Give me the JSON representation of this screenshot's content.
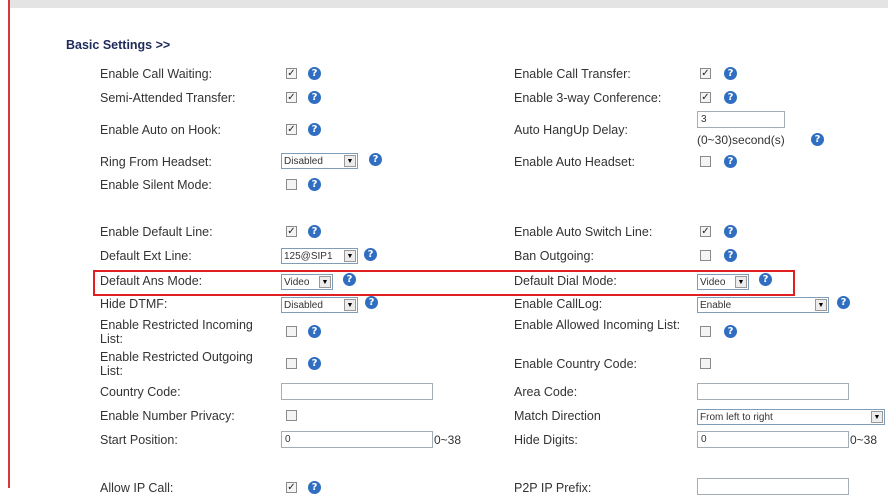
{
  "section_title": "Basic Settings >>",
  "glyphs": {
    "check": "✓",
    "help": "?",
    "arrow": "▼"
  },
  "colors": {
    "highlight": "#e02020",
    "help_icon": "#2f6ec1",
    "title": "#1e2a5a"
  },
  "rows": {
    "call_waiting": {
      "label": "Enable Call Waiting:",
      "checked": true
    },
    "call_transfer": {
      "label": "Enable Call Transfer:",
      "checked": true
    },
    "semi_attended": {
      "label": "Semi-Attended Transfer:",
      "checked": true
    },
    "three_way": {
      "label": "Enable 3-way Conference:",
      "checked": true
    },
    "auto_on_hook": {
      "label": "Enable Auto on Hook:",
      "checked": true
    },
    "auto_hangup": {
      "label": "Auto HangUp Delay:",
      "value": "3",
      "hint": "(0~30)second(s)"
    },
    "ring_headset": {
      "label": "Ring From Headset:",
      "value": "Disabled"
    },
    "auto_headset": {
      "label": "Enable Auto Headset:",
      "checked": false
    },
    "silent_mode": {
      "label": "Enable Silent Mode:",
      "checked": false
    },
    "default_line": {
      "label": "Enable Default Line:",
      "checked": true
    },
    "auto_switch": {
      "label": "Enable Auto Switch Line:",
      "checked": true
    },
    "default_ext": {
      "label": "Default Ext Line:",
      "value": "125@SIP1"
    },
    "ban_outgoing": {
      "label": "Ban Outgoing:",
      "checked": false
    },
    "ans_mode": {
      "label": "Default Ans Mode:",
      "value": "Video"
    },
    "dial_mode": {
      "label": "Default Dial Mode:",
      "value": "Video"
    },
    "hide_dtmf": {
      "label": "Hide DTMF:",
      "value": "Disabled"
    },
    "call_log": {
      "label": "Enable CallLog:",
      "value": "Enable"
    },
    "restricted_in": {
      "label": "Enable Restricted Incoming List:",
      "checked": false
    },
    "allowed_in": {
      "label": "Enable Allowed Incoming List:",
      "checked": false
    },
    "restricted_out": {
      "label": "Enable Restricted Outgoing List:",
      "checked": false
    },
    "country_code_en": {
      "label": "Enable Country Code:",
      "checked": false
    },
    "country_code": {
      "label": "Country Code:",
      "value": ""
    },
    "area_code": {
      "label": "Area Code:",
      "value": ""
    },
    "number_privacy": {
      "label": "Enable Number Privacy:",
      "checked": false
    },
    "match_direction": {
      "label": "Match Direction",
      "value": "From left to right"
    },
    "start_position": {
      "label": "Start Position:",
      "value": "0",
      "hint": "0~38"
    },
    "hide_digits": {
      "label": "Hide Digits:",
      "value": "0",
      "hint": "0~38"
    },
    "allow_ip_call": {
      "label": "Allow IP Call:",
      "checked": true
    },
    "p2p_prefix": {
      "label": "P2P IP Prefix:",
      "value": ""
    }
  }
}
